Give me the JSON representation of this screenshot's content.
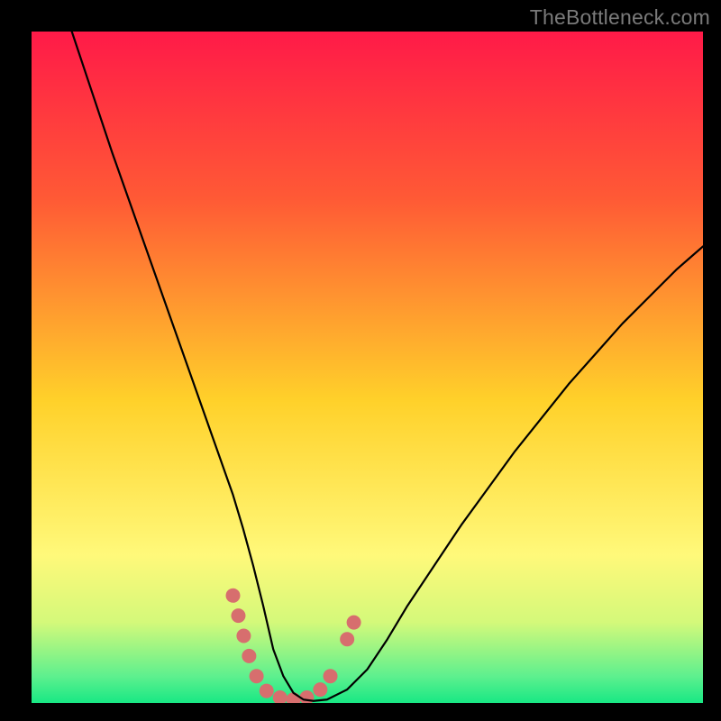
{
  "watermark": "TheBottleneck.com",
  "chart_data": {
    "type": "line",
    "title": "",
    "xlabel": "",
    "ylabel": "",
    "xlim": [
      0,
      100
    ],
    "ylim": [
      0,
      100
    ],
    "grid": false,
    "legend": false,
    "background_gradient": {
      "stops": [
        {
          "offset": 0.0,
          "color": "#ff1a48"
        },
        {
          "offset": 0.25,
          "color": "#ff5a35"
        },
        {
          "offset": 0.55,
          "color": "#ffd12a"
        },
        {
          "offset": 0.78,
          "color": "#fff97a"
        },
        {
          "offset": 0.88,
          "color": "#d4f97a"
        },
        {
          "offset": 0.96,
          "color": "#5ef08e"
        },
        {
          "offset": 1.0,
          "color": "#18e884"
        }
      ]
    },
    "series": [
      {
        "name": "bottleneck-curve",
        "color": "#000000",
        "width": 2.2,
        "x": [
          6,
          9,
          12,
          15,
          18,
          21,
          24,
          27,
          30,
          31.5,
          33,
          34.5,
          36,
          37.5,
          39,
          40.5,
          42,
          44,
          47,
          50,
          53,
          56,
          60,
          64,
          68,
          72,
          76,
          80,
          84,
          88,
          92,
          96,
          100
        ],
        "y": [
          100,
          91,
          82,
          73.5,
          65,
          56.5,
          48,
          39.5,
          31,
          26,
          20.5,
          14.5,
          8,
          4,
          1.5,
          0.5,
          0.3,
          0.5,
          2,
          5,
          9.5,
          14.5,
          20.5,
          26.5,
          32,
          37.5,
          42.5,
          47.5,
          52,
          56.5,
          60.5,
          64.5,
          68
        ]
      }
    ],
    "markers": [
      {
        "name": "highlight-dots",
        "color": "#d76e6e",
        "radius": 8,
        "points": [
          {
            "x": 30.0,
            "y": 16.0
          },
          {
            "x": 30.8,
            "y": 13.0
          },
          {
            "x": 31.6,
            "y": 10.0
          },
          {
            "x": 32.4,
            "y": 7.0
          },
          {
            "x": 33.5,
            "y": 4.0
          },
          {
            "x": 35.0,
            "y": 1.8
          },
          {
            "x": 37.0,
            "y": 0.8
          },
          {
            "x": 39.0,
            "y": 0.5
          },
          {
            "x": 41.0,
            "y": 0.8
          },
          {
            "x": 43.0,
            "y": 2.0
          },
          {
            "x": 44.5,
            "y": 4.0
          },
          {
            "x": 47.0,
            "y": 9.5
          },
          {
            "x": 48.0,
            "y": 12.0
          }
        ]
      }
    ]
  }
}
